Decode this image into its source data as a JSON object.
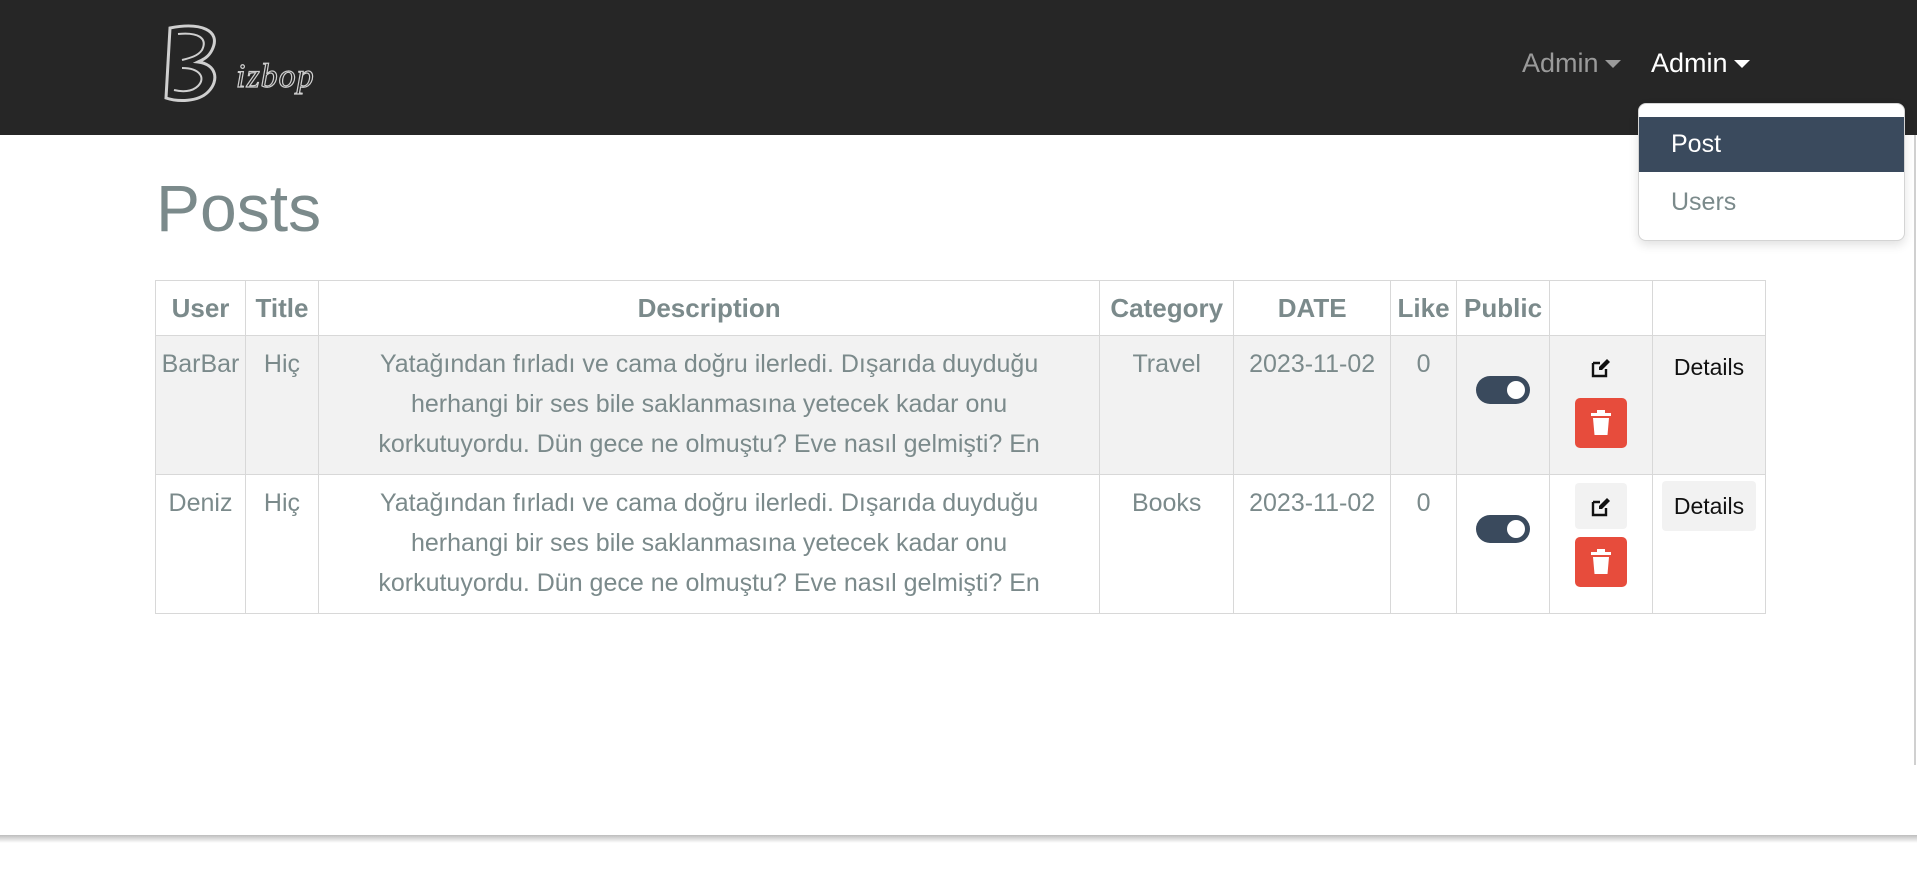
{
  "brand": {
    "logo_letter": "B",
    "logo_text": "izbop"
  },
  "navbar": {
    "dropdowns": [
      {
        "label": "Admin"
      },
      {
        "label": "Admin"
      }
    ],
    "menu": {
      "items": [
        {
          "label": "Post",
          "active": true
        },
        {
          "label": "Users",
          "active": false
        }
      ]
    }
  },
  "page": {
    "title": "Posts"
  },
  "table": {
    "headers": [
      "User",
      "Title",
      "Description",
      "Category",
      "DATE",
      "Like",
      "Public",
      "",
      ""
    ],
    "rows": [
      {
        "user": "BarBar",
        "title": "Hiç",
        "description": "Yatağından fırladı ve cama doğru ilerledi. Dışarıda duyduğu herhangi bir ses bile saklanmasına yetecek kadar onu korkutuyordu. Dün gece ne olmuştu? Eve nasıl gelmişti? En",
        "category": "Travel",
        "date": "2023-11-02",
        "like": "0",
        "public": true,
        "details_label": "Details"
      },
      {
        "user": "Deniz",
        "title": "Hiç",
        "description": "Yatağından fırladı ve cama doğru ilerledi. Dışarıda duyduğu herhangi bir ses bile saklanmasına yetecek kadar onu korkutuyordu. Dün gece ne olmuştu? Eve nasıl gelmişti? En",
        "category": "Books",
        "date": "2023-11-02",
        "like": "0",
        "public": true,
        "details_label": "Details"
      }
    ]
  },
  "icons": {
    "edit": "edit-icon",
    "delete": "trash-icon"
  },
  "colors": {
    "navbar": "#262626",
    "primary": "#3a4a5d",
    "danger": "#e74c3c",
    "text": "#7b8a8b"
  }
}
